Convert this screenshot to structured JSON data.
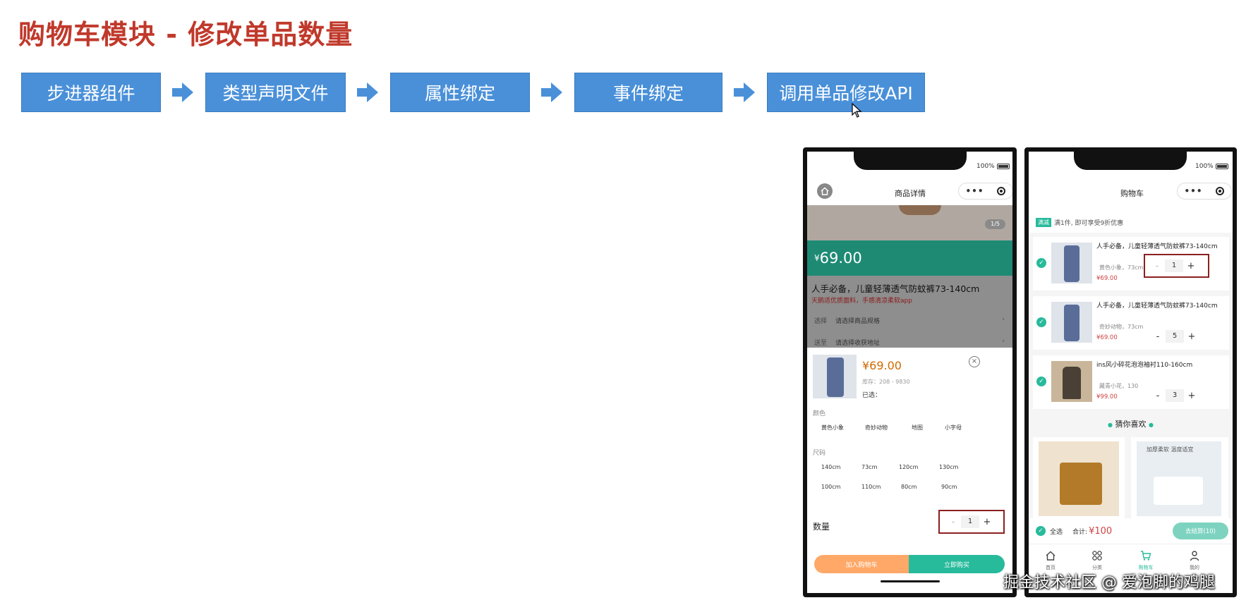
{
  "slide": {
    "title": "购物车模块 - 修改单品数量",
    "steps": [
      "步进器组件",
      "类型声明文件",
      "属性绑定",
      "事件绑定",
      "调用单品修改API"
    ]
  },
  "phone_detail": {
    "battery": "100%",
    "nav_title": "商品详情",
    "gallery_counter": "1/5",
    "price_symbol": "¥",
    "price": "69.00",
    "product_name": "人手必备，儿童轻薄透气防蚊裤73-140cm",
    "product_desc": "天鹅适优质面料，手感清凉柔软app",
    "rows": [
      {
        "label": "选择",
        "value": "请选择商品规格"
      },
      {
        "label": "送至",
        "value": "请选择收获地址"
      }
    ],
    "sku": {
      "price": "¥69.00",
      "stock": "库存：208 - 9830",
      "selected": "已选：",
      "color_label": "颜色",
      "colors": [
        "黄色小象",
        "奇妙动物",
        "地图",
        "小字母"
      ],
      "size_label": "尺码",
      "sizes": [
        "140cm",
        "73cm",
        "120cm",
        "130cm",
        "100cm",
        "110cm",
        "80cm",
        "90cm"
      ],
      "qty_label": "数量",
      "qty_value": "1"
    },
    "buttons": {
      "cart": "加入购物车",
      "buy": "立即购买"
    },
    "colors": {
      "accent": "#27ba9b",
      "cart_btn": "#ffa868",
      "buy_btn": "#27ba9b",
      "price_red": "#cf4444"
    }
  },
  "phone_cart": {
    "battery": "100%",
    "nav_title": "购物车",
    "promo_tag": "满减",
    "promo_text": "满1件, 即可享受9折优惠",
    "items": [
      {
        "name": "人手必备，儿童轻薄透气防蚊裤73-140cm",
        "spec": "黄色小象，73cm",
        "price": "¥69.00",
        "qty": "1"
      },
      {
        "name": "人手必备，儿童轻薄透气防蚊裤73-140cm",
        "spec": "奇妙动物，73cm",
        "price": "¥69.00",
        "qty": "5"
      },
      {
        "name": "ins风小碎花泡泡袖衬110-160cm",
        "spec": "藏青小花，130",
        "price": "¥99.00",
        "qty": "3"
      }
    ],
    "guess_title": "猜你喜欢",
    "guess_items": [
      "",
      "加厚柔软 温度适宜"
    ],
    "footer": {
      "select_all": "全选",
      "total_label": "合计:",
      "total": "¥100",
      "checkout": "去结算(10)"
    },
    "tabs": [
      "首页",
      "分类",
      "购物车",
      "我的"
    ]
  },
  "watermark": "掘金技术社区 @ 爱泡脚的鸡腿"
}
